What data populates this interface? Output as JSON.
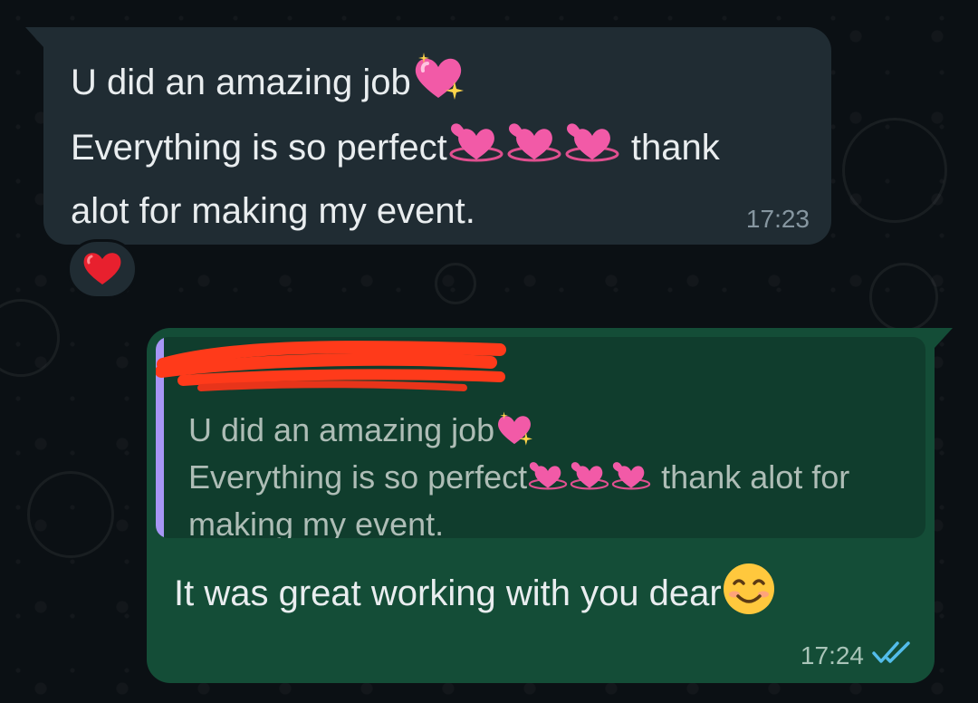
{
  "incoming": {
    "line1": "U did an amazing job",
    "line2": "Everything is so perfect",
    "line2_end": " thank",
    "line3": "alot for making my event.",
    "time": "17:23"
  },
  "reaction": {
    "emoji_name": "red-heart-icon"
  },
  "outgoing": {
    "quote": {
      "author": "",
      "line1": "U did an amazing job",
      "line2": "Everything is so perfect",
      "line2_end": " thank alot for",
      "line3": "making my event."
    },
    "message": "It was great working with you dear",
    "time": "17:24",
    "status_icon": "double-check-read-icon"
  },
  "colors": {
    "background": "#0b1014",
    "incoming_bubble": "#202c33",
    "outgoing_bubble": "#144d37",
    "quote_bar": "#a796f5",
    "read_ticks": "#53bdeb"
  }
}
